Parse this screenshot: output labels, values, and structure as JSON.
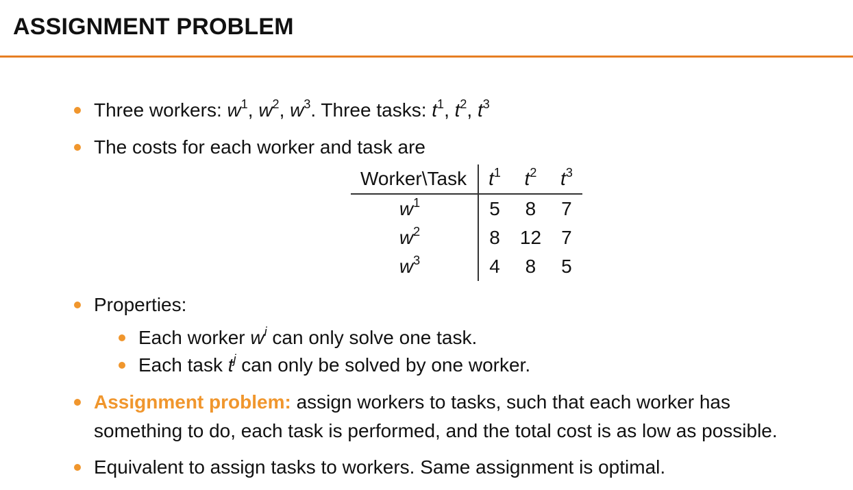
{
  "title": "ASSIGNMENT PROBLEM",
  "bullet1": {
    "prefix": "Three workers:",
    "workers": [
      "w",
      "w",
      "w"
    ],
    "worker_sups": [
      "1",
      "2",
      "3"
    ],
    "mid": ". Three tasks:",
    "tasks": [
      "t",
      "t",
      "t"
    ],
    "task_sups": [
      "1",
      "2",
      "3"
    ]
  },
  "bullet2": {
    "text": "The costs for each worker and task are"
  },
  "table": {
    "corner": "Worker\\Task",
    "col_symbol": "t",
    "col_sups": [
      "1",
      "2",
      "3"
    ],
    "row_symbol": "w",
    "rows": [
      {
        "sup": "1",
        "values": [
          "5",
          "8",
          "7"
        ]
      },
      {
        "sup": "2",
        "values": [
          "8",
          "12",
          "7"
        ]
      },
      {
        "sup": "3",
        "values": [
          "4",
          "8",
          "5"
        ]
      }
    ]
  },
  "bullet3": {
    "text": "Properties:",
    "sub1": {
      "before": "Each worker",
      "symbol": "w",
      "sup": "i",
      "after": "can only solve one task."
    },
    "sub2": {
      "before": "Each task",
      "symbol": "t",
      "sup": "j",
      "after": "can only be solved by one worker."
    }
  },
  "bullet4": {
    "highlight": "Assignment problem:",
    "line1": "assign workers to tasks, such that each worker has",
    "line2": "something to do, each task is performed, and the total cost is as low as possible."
  },
  "bullet5": {
    "text": "Equivalent to assign tasks to workers. Same assignment is optimal."
  },
  "colors": {
    "accent": "#f0962d",
    "rule": "#e67e22"
  }
}
